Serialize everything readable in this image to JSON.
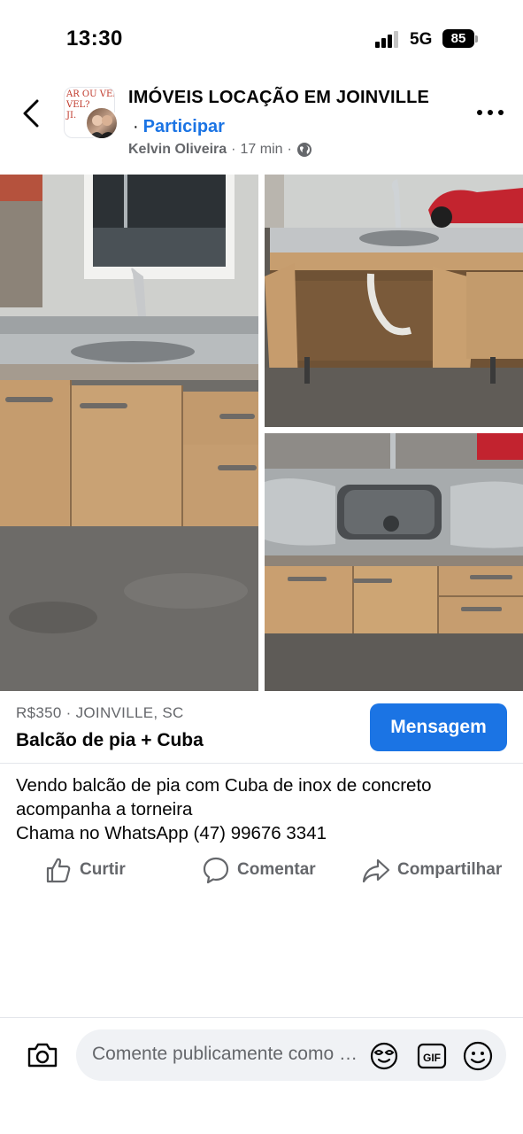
{
  "status_bar": {
    "time": "13:30",
    "network": "5G",
    "battery": "85"
  },
  "post": {
    "group_name": "IMÓVEIS LOCAÇÃO EM JOINVILLE",
    "join_label": "Participar",
    "author": "Kelvin Oliveira",
    "time_ago": "17 min",
    "group_avatar_text": "AR OU VENDE\nVEL?\nJI.",
    "icons": {
      "back": "chevron-left-icon",
      "more": "more-horizontal-icon",
      "privacy": "globe-icon"
    }
  },
  "listing": {
    "meta": "R$350 · JOINVILLE, SC",
    "title": "Balcão de pia + Cuba",
    "message_button": "Mensagem"
  },
  "description": {
    "line1": "Vendo balcão de pia com Cuba de inox de concreto",
    "line2": "acompanha a torneira",
    "line3": "Chama no WhatsApp (47) 99676 3341"
  },
  "actions": {
    "like": "Curtir",
    "comment": "Comentar",
    "share": "Compartilhar"
  },
  "composer": {
    "placeholder": "Comente publicamente como Kelvin Oliveira",
    "icons": [
      "camera-icon",
      "avatar-sticker-icon",
      "gif-icon",
      "emoji-icon"
    ]
  },
  "colors": {
    "accent": "#1b74e4",
    "secondary_text": "#65676b",
    "field_background": "#f0f2f5"
  }
}
